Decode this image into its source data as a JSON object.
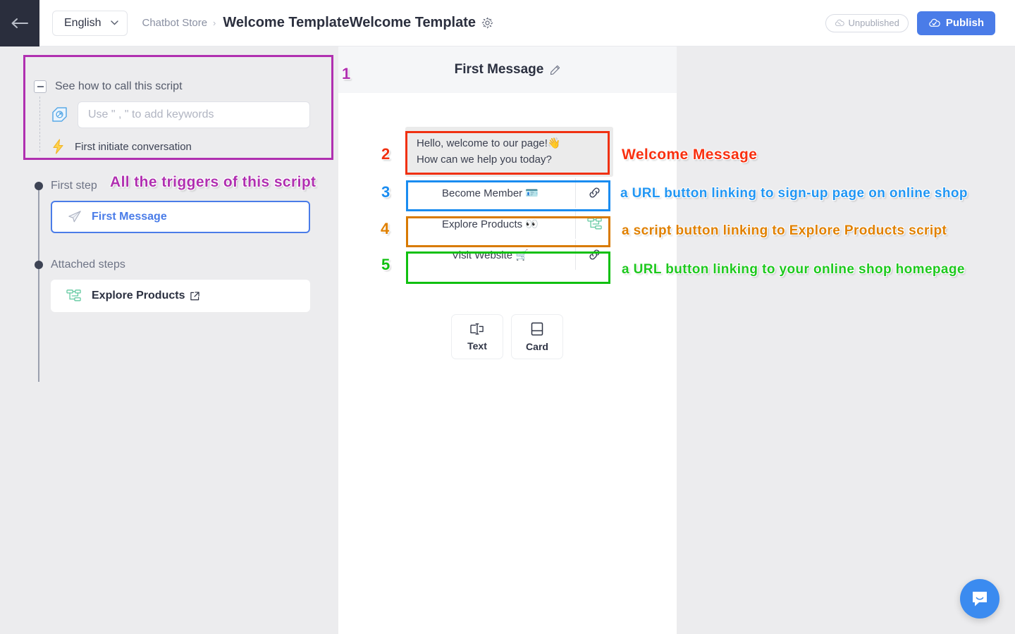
{
  "topbar": {
    "back_icon": "back-arrow-icon",
    "language": "English",
    "chevron_icon": "chevron-down-icon",
    "breadcrumb_parent": "Chatbot Store",
    "breadcrumb_separator": "›",
    "page_title": "Welcome TemplateWelcome Template",
    "settings_icon": "gear-icon",
    "unpublished_label": "Unpublished",
    "unpublished_icon": "cloud-off-icon",
    "publish_label": "Publish",
    "publish_icon": "cloud-upload-icon",
    "publish_color": "#4a7ce8"
  },
  "sidebar": {
    "trigger_section": {
      "collapse_label": "See how to call this script",
      "keyword_placeholder": "Use \" , \" to add keywords",
      "keyword_value": "",
      "keyword_icon": "tag-icon",
      "trigger_item_label": "First initiate conversation",
      "trigger_item_icon": "lightning-bolt-icon"
    },
    "first_step_label": "First step",
    "first_step_card": {
      "label": "First Message",
      "icon": "paper-plane-icon"
    },
    "attached_steps_label": "Attached steps",
    "attached_step_card": {
      "label": "Explore Products",
      "icon": "flow-script-icon",
      "external_icon": "external-link-icon"
    }
  },
  "canvas": {
    "title": "First Message",
    "edit_icon": "pencil-icon",
    "message": {
      "line1": "Hello, welcome to our page!👋",
      "line2": "How can we help you today?"
    },
    "buttons": [
      {
        "label": "Become Member 🪪",
        "icon": "link-icon",
        "type": "url"
      },
      {
        "label": "Explore Products 👀",
        "icon": "flow-script-icon",
        "type": "script"
      },
      {
        "label": "Visit Website 🛒",
        "icon": "link-icon",
        "type": "url"
      }
    ],
    "add_tiles": [
      {
        "label": "Text",
        "icon": "text-cursor-icon"
      },
      {
        "label": "Card",
        "icon": "card-icon"
      }
    ]
  },
  "annotations": {
    "markers": [
      {
        "number": "1",
        "color": "#b030b0"
      },
      {
        "number": "2",
        "color": "#f03010"
      },
      {
        "number": "3",
        "color": "#1a8cf0"
      },
      {
        "number": "4",
        "color": "#e08000"
      },
      {
        "number": "5",
        "color": "#10c010"
      }
    ],
    "notes": [
      {
        "text": "All the triggers of this script",
        "color": "#b030b0"
      },
      {
        "text": "Welcome Message",
        "color": "#f83010"
      },
      {
        "text": "a URL button linking to sign-up page on online shop",
        "color": "#2196f3"
      },
      {
        "text": "a script button linking to Explore Products script",
        "color": "#e08000"
      },
      {
        "text": "a URL button linking to your online shop homepage",
        "color": "#1ec81e"
      }
    ]
  },
  "chat_launcher": {
    "icon": "chat-bubble-icon",
    "color": "#3b8bf0"
  }
}
